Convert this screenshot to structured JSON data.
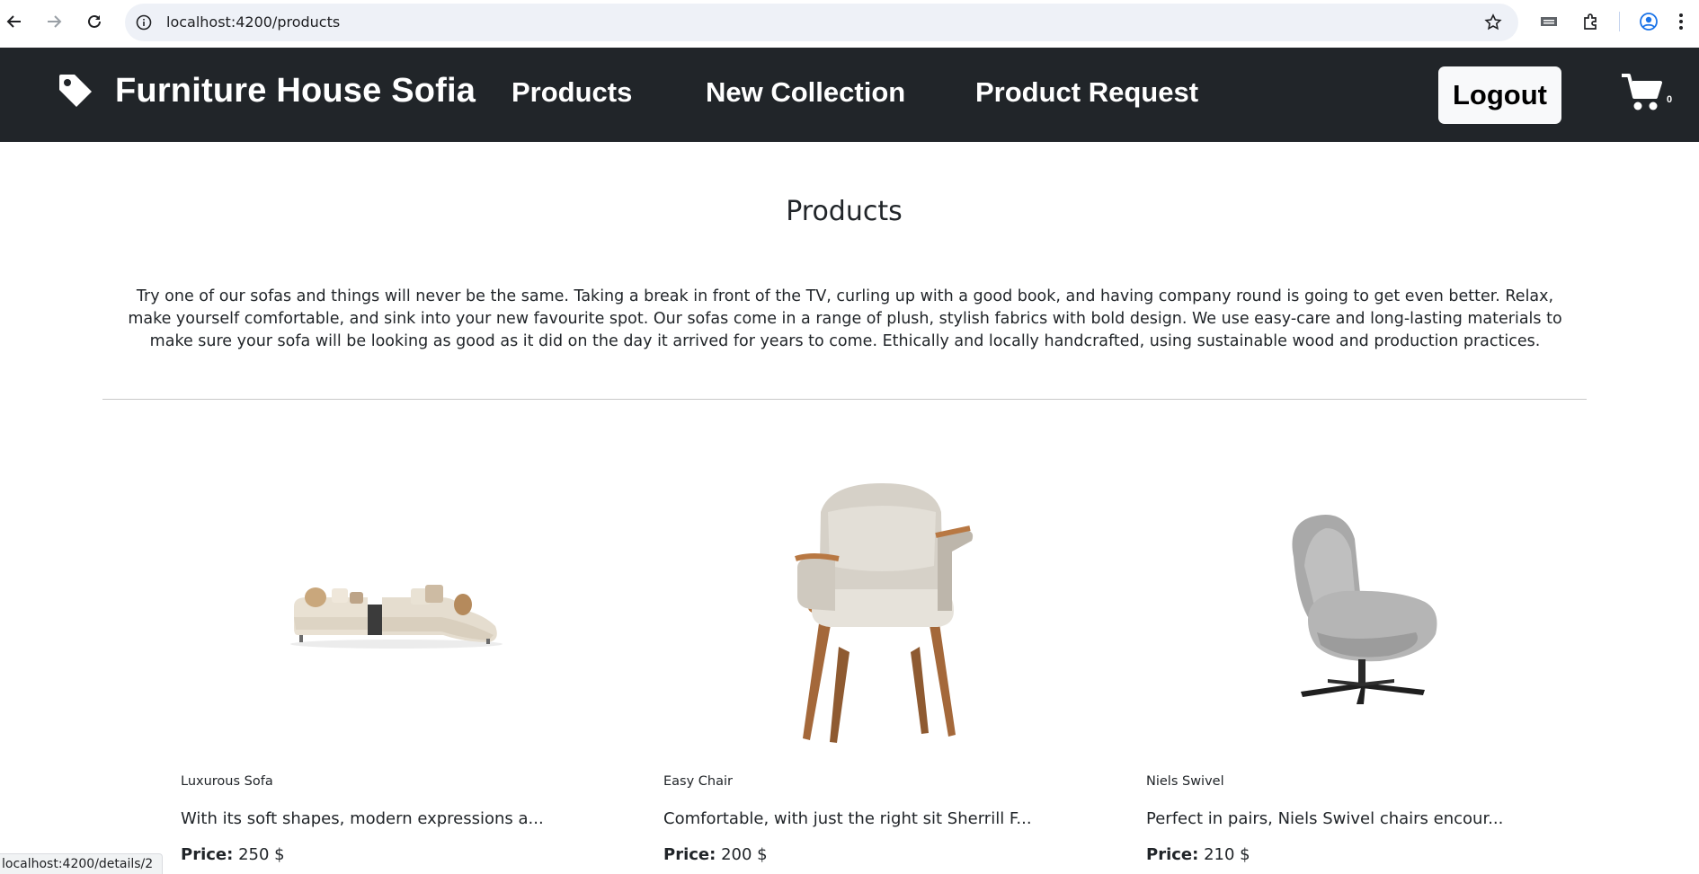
{
  "browser": {
    "url": "localhost:4200/products",
    "status_url": "localhost:4200/details/2"
  },
  "navbar": {
    "brand": "Furniture House Sofia",
    "links": [
      "Products",
      "New Collection",
      "Product Request"
    ],
    "logout": "Logout",
    "cart_count": "0"
  },
  "page": {
    "title": "Products",
    "intro": "Try one of our sofas and things will never be the same. Taking a break in front of the TV, curling up with a good book, and having company round is going to get even better. Relax, make yourself comfortable, and sink into your new favourite spot. Our sofas come in a range of plush, stylish fabrics with bold design. We use easy-care and long-lasting materials to make sure your sofa will be looking as good as it did on the day it arrived for years to come. Ethically and locally handcrafted, using sustainable wood and production practices."
  },
  "products": [
    {
      "name": "Luxurous Sofa",
      "description": "With its soft shapes, modern expressions a...",
      "price_label": "Price:",
      "price": "250 $"
    },
    {
      "name": "Easy Chair",
      "description": "Comfortable, with just the right sit Sherrill F...",
      "price_label": "Price:",
      "price": "200 $"
    },
    {
      "name": "Niels Swivel",
      "description": "Perfect in pairs, Niels Swivel chairs encour...",
      "price_label": "Price:",
      "price": "210 $"
    }
  ],
  "colors": {
    "navbar_bg": "#212529",
    "navbar_text": "#ffffff",
    "logout_bg": "#f8f9fa"
  }
}
